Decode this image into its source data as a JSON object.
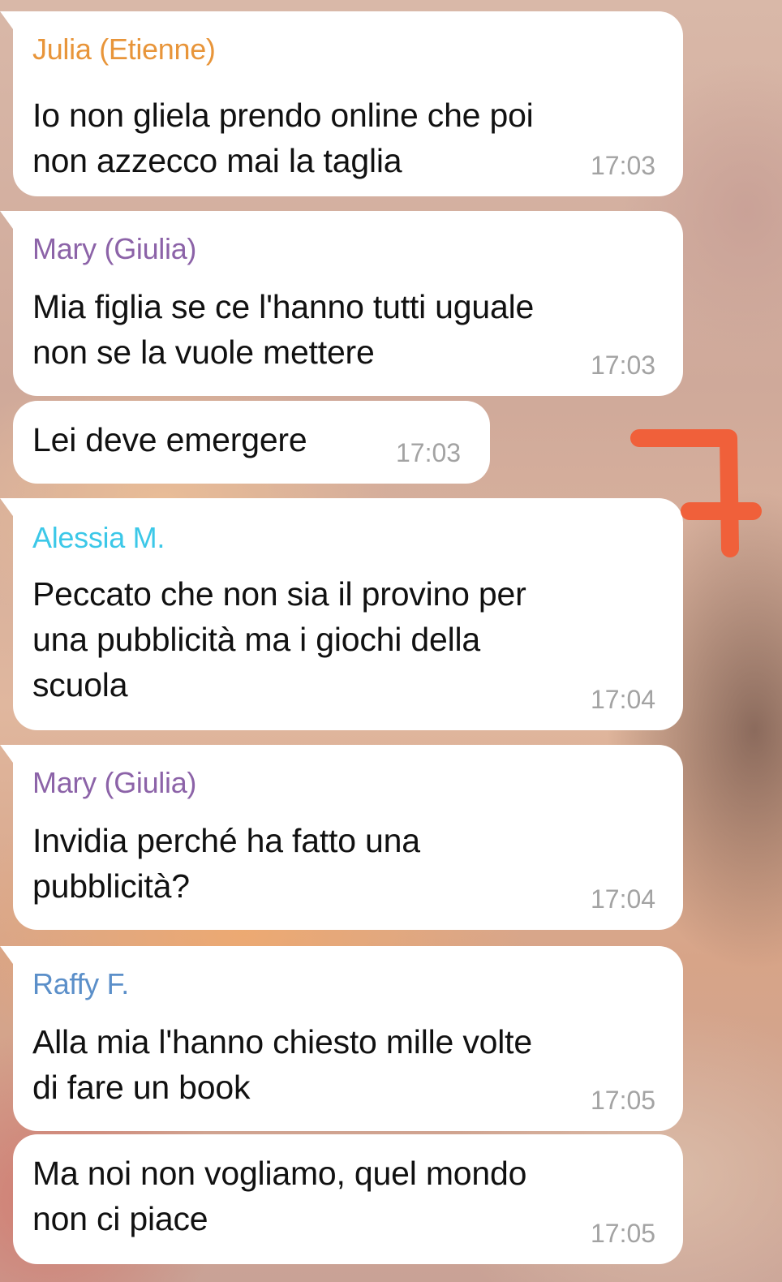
{
  "colors": {
    "julia": "#e8953a",
    "mary": "#8c63a8",
    "alessia": "#3cc8e8",
    "raffy": "#5b8fc9",
    "time": "#a3a3a3",
    "annotation": "#f0603a"
  },
  "messages": [
    {
      "sender": "Julia (Etienne)",
      "lines": [
        "Io non gliela prendo online che poi",
        "non azzecco mai la taglia"
      ],
      "time": "17:03"
    },
    {
      "sender": "Mary (Giulia)",
      "lines": [
        "Mia figlia se ce l'hanno tutti uguale",
        "non se la vuole mettere"
      ],
      "time": "17:03"
    },
    {
      "sender": "",
      "lines": [
        "Lei deve emergere"
      ],
      "time": "17:03"
    },
    {
      "sender": "Alessia M.",
      "lines": [
        "Peccato che non sia il provino per",
        "una pubblicità ma i giochi della",
        "scuola"
      ],
      "time": "17:04"
    },
    {
      "sender": "Mary (Giulia)",
      "lines": [
        "Invidia perché ha fatto una",
        "pubblicità?"
      ],
      "time": "17:04"
    },
    {
      "sender": "Raffy F.",
      "lines": [
        "Alla mia l'hanno chiesto mille volte",
        "di fare un book"
      ],
      "time": "17:05"
    },
    {
      "sender": "",
      "lines": [
        "Ma noi non vogliamo, quel mondo",
        "non ci piace"
      ],
      "time": "17:05"
    }
  ]
}
